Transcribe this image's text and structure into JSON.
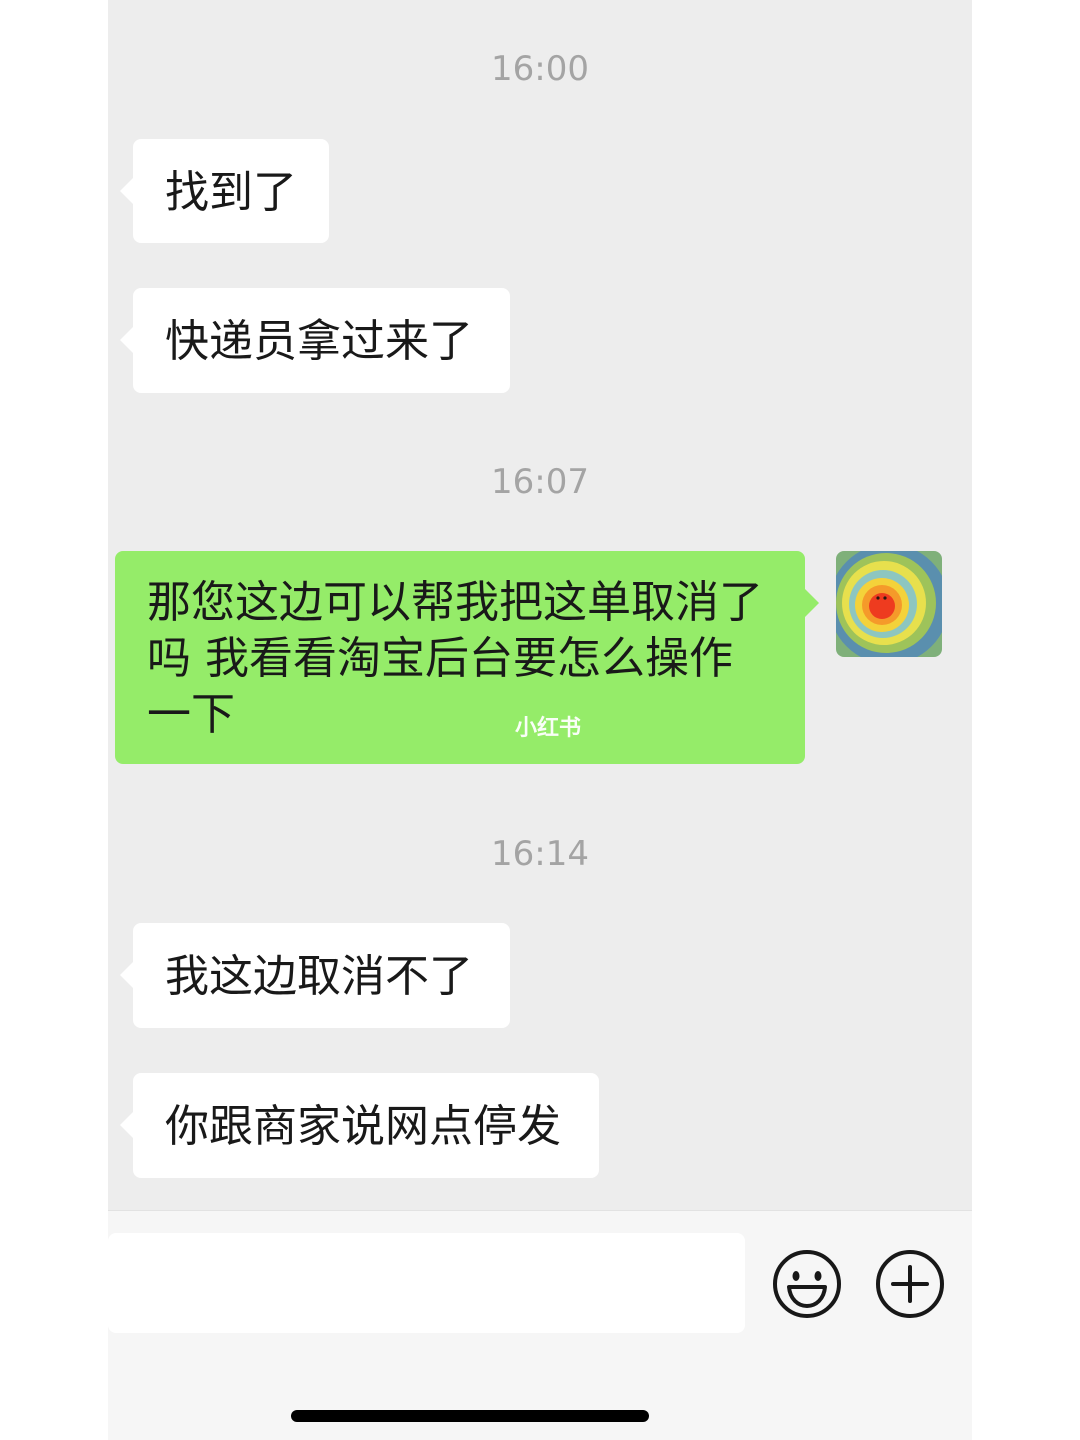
{
  "chat": {
    "timestamps": [
      "16:00",
      "16:07",
      "16:14"
    ],
    "messages": [
      {
        "side": "left",
        "text": "找到了"
      },
      {
        "side": "left",
        "text": "快递员拿过来了"
      },
      {
        "side": "right",
        "text": "那您这边可以帮我把这单取消了吗  我看看淘宝后台要怎么操作一下"
      },
      {
        "side": "left",
        "text": "我这边取消不了"
      },
      {
        "side": "left",
        "text": "你跟商家说网点停发"
      }
    ],
    "watermark": "小红书"
  },
  "input_bar": {
    "emoji_icon": "smiley-face-icon",
    "more_icon": "plus-circle-icon"
  },
  "colors": {
    "background": "#ededed",
    "bubble_left": "#ffffff",
    "bubble_right": "#95ec69",
    "timestamp": "#a4a4a4",
    "text": "#191919"
  }
}
